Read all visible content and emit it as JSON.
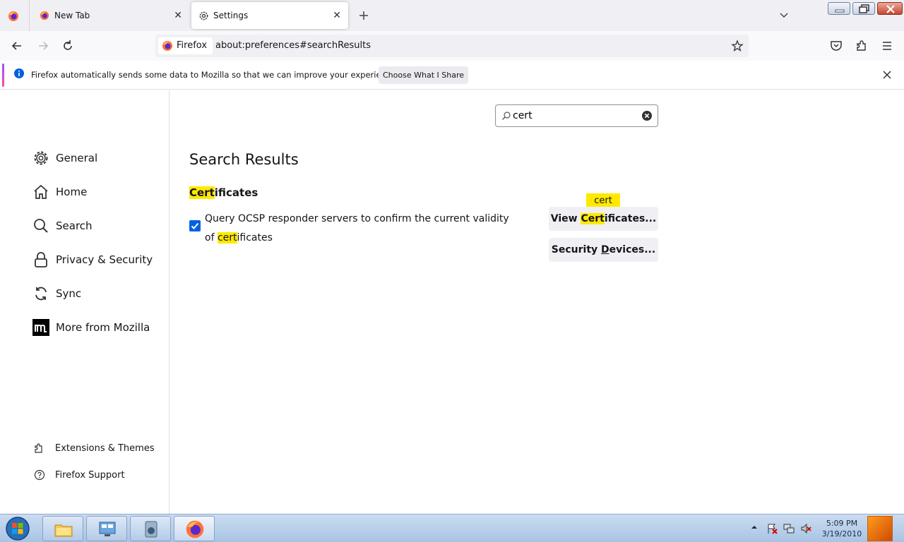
{
  "tabs": [
    {
      "label": "New Tab",
      "icon": "firefox-icon"
    },
    {
      "label": "Settings",
      "icon": "gear-icon",
      "active": true
    }
  ],
  "urlbar": {
    "identity_label": "Firefox",
    "url": "about:preferences#searchResults"
  },
  "notification": {
    "message": "Firefox automatically sends some data to Mozilla so that we can improve your experience.",
    "button_label": "Choose What I Share"
  },
  "sidebar": {
    "categories": [
      {
        "label": "General",
        "icon": "gear-icon"
      },
      {
        "label": "Home",
        "icon": "home-icon"
      },
      {
        "label": "Search",
        "icon": "search-icon"
      },
      {
        "label": "Privacy & Security",
        "icon": "lock-icon"
      },
      {
        "label": "Sync",
        "icon": "sync-icon"
      },
      {
        "label": "More from Mozilla",
        "icon": "mozilla-icon"
      }
    ],
    "footer": [
      {
        "label": "Extensions & Themes",
        "icon": "puzzle-icon"
      },
      {
        "label": "Firefox Support",
        "icon": "help-icon"
      }
    ]
  },
  "main": {
    "search_value": "cert",
    "results_title": "Search Results",
    "section_title_highlight": "Cert",
    "section_title_rest": "ificates",
    "ocsp_text_before": "Query OCSP responder servers to confirm the current validity of ",
    "ocsp_text_highlight": "cert",
    "ocsp_text_after": "ificates",
    "ocsp_checked": true,
    "tooltip": "cert",
    "view_button": {
      "before": "View ",
      "highlight": "Cert",
      "after": "ificates..."
    },
    "security_button": {
      "before": "Security ",
      "underline": "D",
      "after": "evices..."
    }
  },
  "taskbar": {
    "time": "5:09 PM",
    "date": "3/19/2010"
  },
  "colors": {
    "highlight": "#ffe900",
    "checkbox": "#0061e0",
    "accent_gradient_start": "#9059ff",
    "accent_gradient_end": "#ff4aa2"
  }
}
